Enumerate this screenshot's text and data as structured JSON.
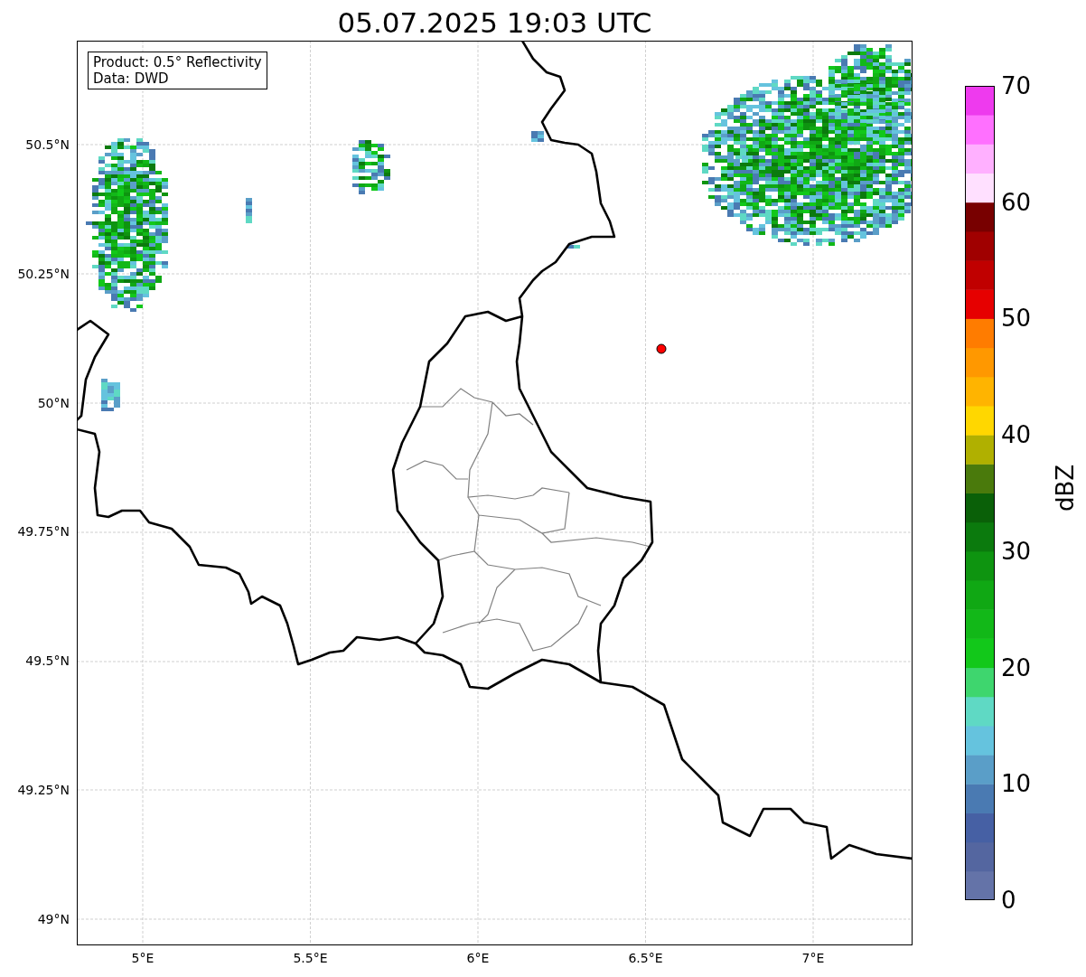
{
  "title": "05.07.2025 19:03 UTC",
  "legend": [
    "Product: 0.5° Reflectivity",
    "Data: DWD"
  ],
  "lat_labels": [
    "50.5°N",
    "50.25°N",
    "50°N",
    "49.75°N",
    "49.5°N",
    "49.25°N",
    "49°N"
  ],
  "lon_labels": [
    "5°E",
    "5.5°E",
    "6°E",
    "6.5°E",
    "7°E"
  ],
  "colorbar": {
    "label": "dBZ",
    "ticks": [
      "70",
      "60",
      "50",
      "40",
      "30",
      "20",
      "10",
      "0"
    ],
    "bins": [
      {
        "color": "#6473a8"
      },
      {
        "color": "#5466a0"
      },
      {
        "color": "#4660a4"
      },
      {
        "color": "#4a7ab2"
      },
      {
        "color": "#5a9ec8"
      },
      {
        "color": "#65c3de"
      },
      {
        "color": "#5fd9c4"
      },
      {
        "color": "#3ed66e"
      },
      {
        "color": "#12c81a"
      },
      {
        "color": "#12b818"
      },
      {
        "color": "#10a814"
      },
      {
        "color": "#0e9410"
      },
      {
        "color": "#0b7a0d"
      },
      {
        "color": "#0a6008"
      },
      {
        "color": "#4a7a0c"
      },
      {
        "color": "#b0b000"
      },
      {
        "color": "#ffd700"
      },
      {
        "color": "#ffb400"
      },
      {
        "color": "#ff9800"
      },
      {
        "color": "#ff7c00"
      },
      {
        "color": "#e60000"
      },
      {
        "color": "#c00000"
      },
      {
        "color": "#a00000"
      },
      {
        "color": "#780000"
      },
      {
        "color": "#ffe0ff"
      },
      {
        "color": "#ffb0ff"
      },
      {
        "color": "#ff70ff"
      },
      {
        "color": "#ee3aee"
      }
    ]
  }
}
